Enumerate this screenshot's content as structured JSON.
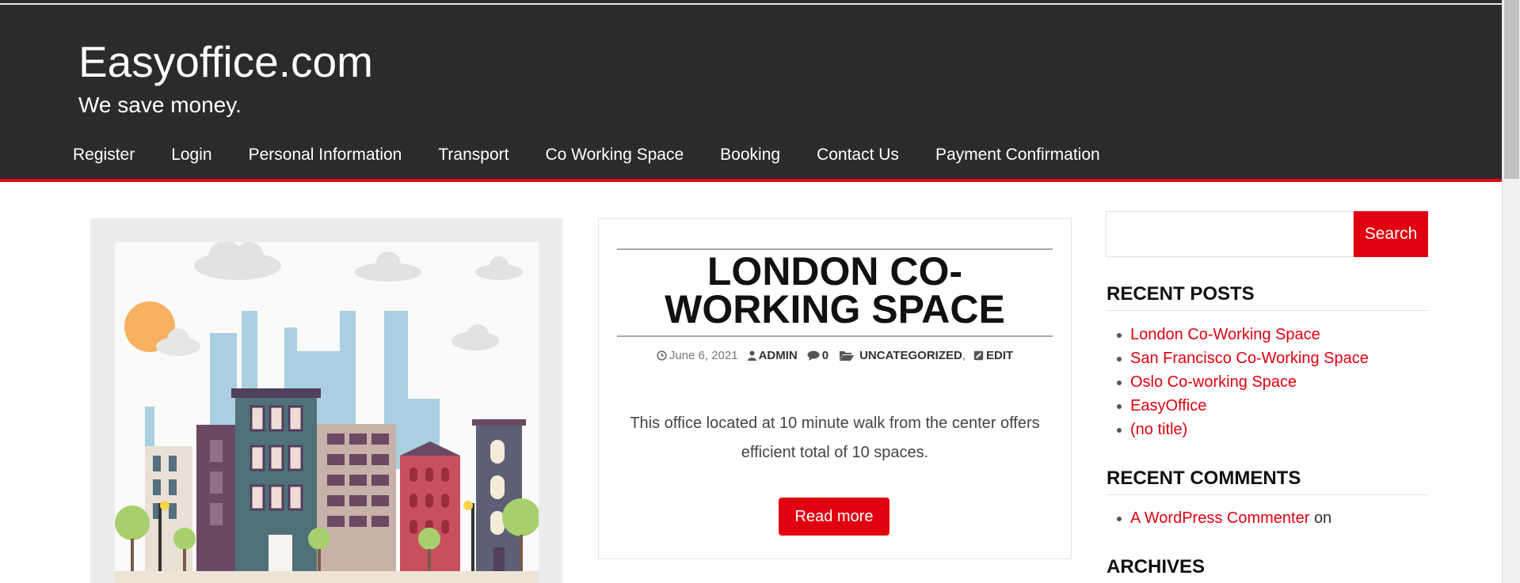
{
  "site": {
    "title": "Easyoffice.com",
    "tagline": "We save money."
  },
  "nav": {
    "items": [
      "Register",
      "Login",
      "Personal Information",
      "Transport",
      "Co Working Space",
      "Booking",
      "Contact Us",
      "Payment Confirmation"
    ]
  },
  "post": {
    "title": "LONDON CO-WORKING SPACE",
    "date": "June 6, 2021",
    "author": "ADMIN",
    "comments": "0",
    "category": "UNCATEGORIZED",
    "category_separator": ",",
    "edit": "EDIT",
    "excerpt": "This office located at 10 minute walk from the center offers efficient total of 10 spaces.",
    "read_more": "Read more"
  },
  "sidebar": {
    "search": {
      "value": "",
      "button": "Search"
    },
    "recent_posts": {
      "title": "RECENT POSTS",
      "items": [
        "London Co-Working Space",
        "San Francisco Co-Working Space",
        "Oslo Co-working Space",
        "EasyOffice",
        "(no title)"
      ]
    },
    "recent_comments": {
      "title": "RECENT COMMENTS",
      "author": "A WordPress Commenter",
      "suffix": "on"
    },
    "archives": {
      "title": "ARCHIVES"
    }
  },
  "icons": {
    "clock": "clock-icon",
    "user": "user-icon",
    "comment": "comment-icon",
    "folder": "folder-icon",
    "edit": "edit-icon"
  },
  "colors": {
    "header_bg": "#2b2b2b",
    "accent": "#e00010",
    "link": "#e00010"
  }
}
